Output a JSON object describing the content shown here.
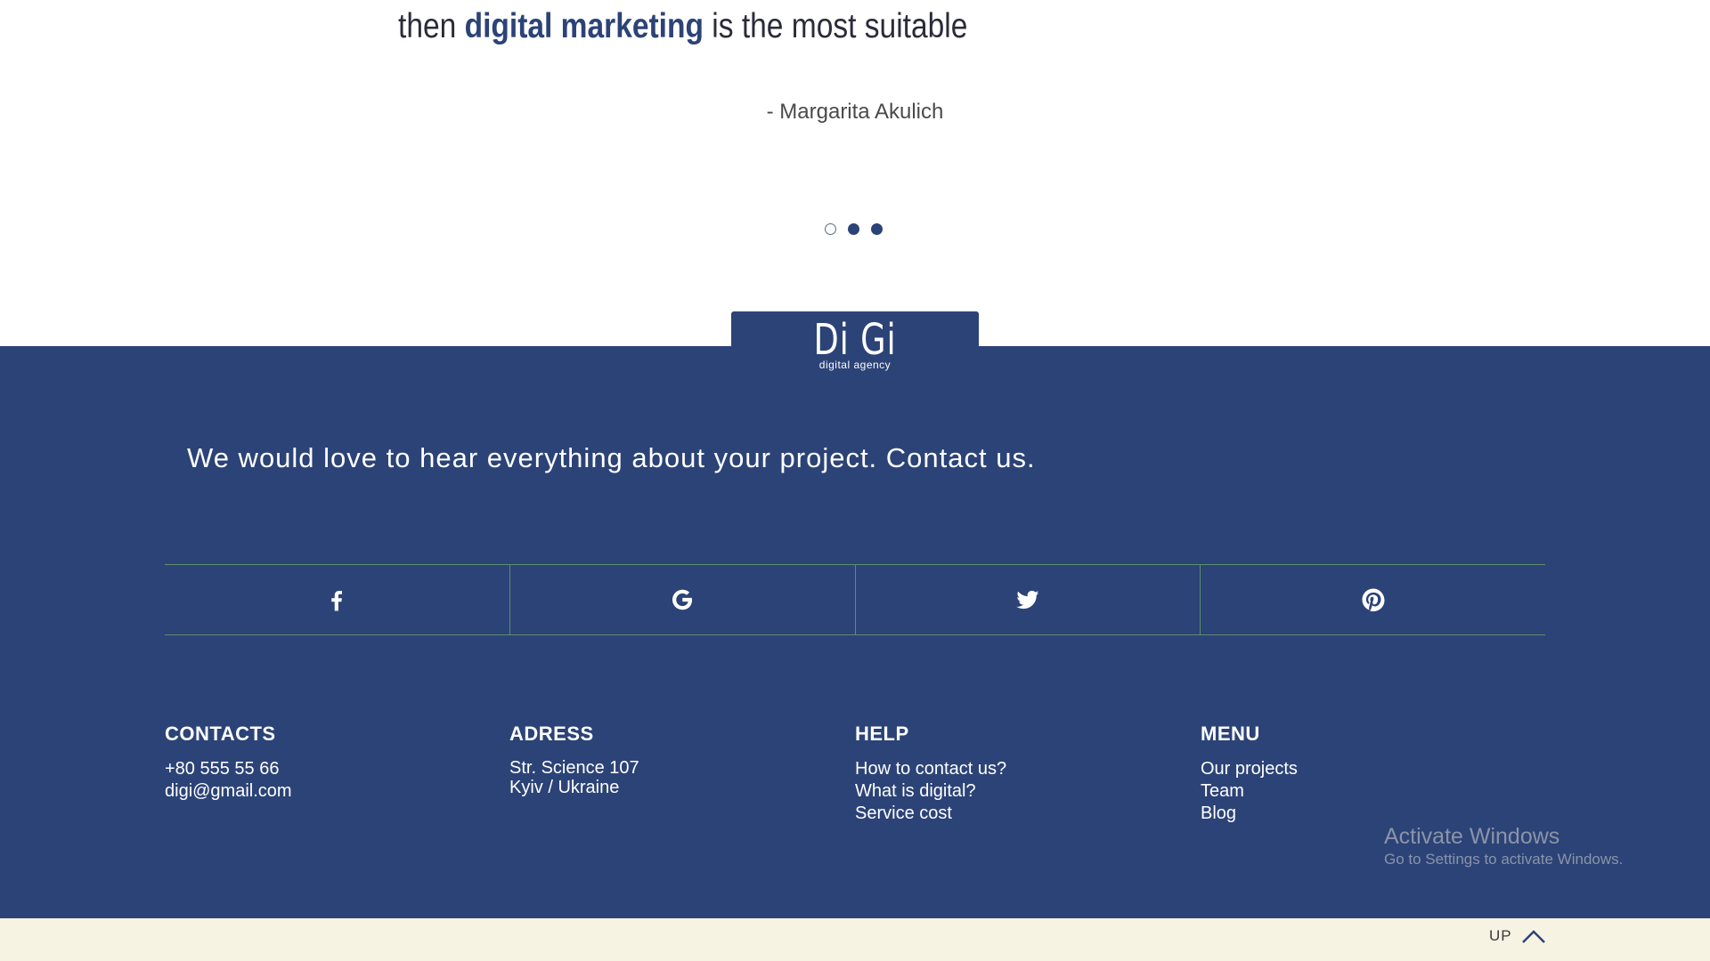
{
  "quote": {
    "prefix": "then ",
    "highlight": "digital marketing",
    "suffix": " is the most suitable",
    "author": "- Margarita Akulich"
  },
  "carousel": {
    "dot_count": 3,
    "active_index": 0
  },
  "logo": {
    "main": "Di Gi",
    "sub": "digital agency"
  },
  "footer": {
    "contact_line": "We would love to hear everything about your project. Contact us.",
    "social": [
      "facebook-icon",
      "google-icon",
      "twitter-icon",
      "pinterest-icon"
    ],
    "contacts": {
      "title": "CONTACTS",
      "phone": "+80 555 55 66",
      "email": "digi@gmail.com"
    },
    "address": {
      "title": "ADRESS",
      "line1": "Str. Science 107",
      "line2": "Kyiv / Ukraine"
    },
    "help": {
      "title": "HELP",
      "items": [
        "How to contact us?",
        "What is digital?",
        "Service cost"
      ]
    },
    "menu": {
      "title": "MENU",
      "items": [
        "Our projects",
        "Team",
        "Blog"
      ]
    }
  },
  "watermark": {
    "title": "Activate Windows",
    "subtitle": "Go to Settings to activate Windows."
  },
  "bottom_bar": {
    "up_label": "UP"
  },
  "colors": {
    "brand": "#2c4377",
    "bottom_bar": "#f7f3e3",
    "divider": "#5b8f6a"
  }
}
